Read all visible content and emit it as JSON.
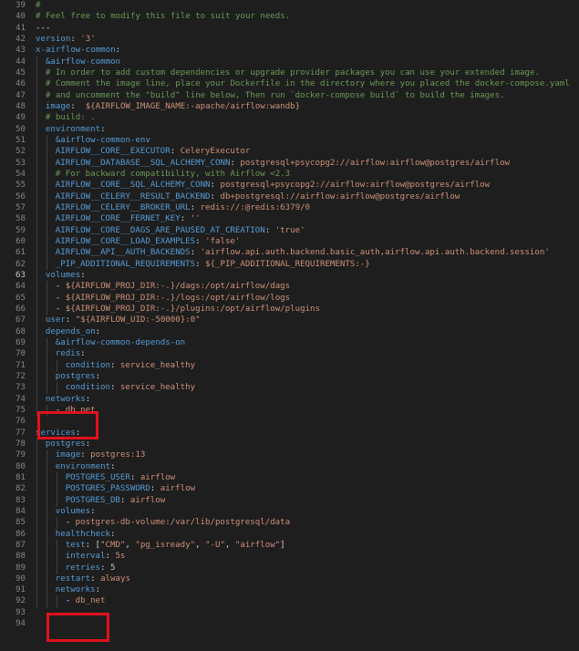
{
  "editor": {
    "language": "yaml",
    "current_line": 63,
    "colors": {
      "background": "#1e1e1e",
      "comment": "#6a9955",
      "key": "#569cd6",
      "string": "#ce9178",
      "number": "#b5cea8",
      "punctuation": "#d4d4d4",
      "line_number": "#858585",
      "highlight_box": "#e0121d"
    },
    "lines": [
      {
        "n": "39",
        "i": 0,
        "t": [
          [
            "cm",
            "#"
          ]
        ]
      },
      {
        "n": "40",
        "i": 0,
        "t": [
          [
            "cm",
            "# Feel free to modify this file to suit your needs."
          ]
        ]
      },
      {
        "n": "41",
        "i": 0,
        "t": [
          [
            "p",
            "---"
          ]
        ]
      },
      {
        "n": "42",
        "i": 0,
        "t": [
          [
            "key",
            "version"
          ],
          [
            "p",
            ": "
          ],
          [
            "str",
            "'3'"
          ]
        ]
      },
      {
        "n": "43",
        "i": 0,
        "t": [
          [
            "key",
            "x-airflow-common"
          ],
          [
            "p",
            ":"
          ]
        ]
      },
      {
        "n": "44",
        "i": 1,
        "t": [
          [
            "anc",
            "&airflow-common"
          ]
        ]
      },
      {
        "n": "45",
        "i": 1,
        "t": [
          [
            "cm",
            "# In order to add custom dependencies or upgrade provider packages you can use your extended image."
          ]
        ]
      },
      {
        "n": "46",
        "i": 1,
        "t": [
          [
            "cm",
            "# Comment the image line, place your Dockerfile in the directory where you placed the docker-compose.yaml"
          ]
        ]
      },
      {
        "n": "47",
        "i": 1,
        "t": [
          [
            "cm",
            "# and uncomment the \"build\" line below, Then run `docker-compose build` to build the images."
          ]
        ]
      },
      {
        "n": "48",
        "i": 1,
        "t": [
          [
            "key",
            "image"
          ],
          [
            "p",
            ":  "
          ],
          [
            "str",
            "${AIRFLOW_IMAGE_NAME:-apache/airflow:wandb}"
          ]
        ]
      },
      {
        "n": "49",
        "i": 1,
        "t": [
          [
            "cm",
            "# build: ."
          ]
        ]
      },
      {
        "n": "50",
        "i": 1,
        "t": [
          [
            "key",
            "environment"
          ],
          [
            "p",
            ":"
          ]
        ]
      },
      {
        "n": "51",
        "i": 2,
        "t": [
          [
            "anc",
            "&airflow-common-env"
          ]
        ]
      },
      {
        "n": "52",
        "i": 2,
        "t": [
          [
            "key",
            "AIRFLOW__CORE__EXECUTOR"
          ],
          [
            "p",
            ": "
          ],
          [
            "str",
            "CeleryExecutor"
          ]
        ]
      },
      {
        "n": "53",
        "i": 2,
        "t": [
          [
            "key",
            "AIRFLOW__DATABASE__SQL_ALCHEMY_CONN"
          ],
          [
            "p",
            ": "
          ],
          [
            "str",
            "postgresql+psycopg2://airflow:airflow@postgres/airflow"
          ]
        ]
      },
      {
        "n": "54",
        "i": 2,
        "t": [
          [
            "cm",
            "# For backward compatibility, with Airflow <2.3"
          ]
        ]
      },
      {
        "n": "55",
        "i": 2,
        "t": [
          [
            "key",
            "AIRFLOW__CORE__SQL_ALCHEMY_CONN"
          ],
          [
            "p",
            ": "
          ],
          [
            "str",
            "postgresql+psycopg2://airflow:airflow@postgres/airflow"
          ]
        ]
      },
      {
        "n": "56",
        "i": 2,
        "t": [
          [
            "key",
            "AIRFLOW__CELERY__RESULT_BACKEND"
          ],
          [
            "p",
            ": "
          ],
          [
            "str",
            "db+postgresql://airflow:airflow@postgres/airflow"
          ]
        ]
      },
      {
        "n": "57",
        "i": 2,
        "t": [
          [
            "key",
            "AIRFLOW__CELERY__BROKER_URL"
          ],
          [
            "p",
            ": "
          ],
          [
            "str",
            "redis://:@redis:6379/0"
          ]
        ]
      },
      {
        "n": "58",
        "i": 2,
        "t": [
          [
            "key",
            "AIRFLOW__CORE__FERNET_KEY"
          ],
          [
            "p",
            ": "
          ],
          [
            "str",
            "''"
          ]
        ]
      },
      {
        "n": "59",
        "i": 2,
        "t": [
          [
            "key",
            "AIRFLOW__CORE__DAGS_ARE_PAUSED_AT_CREATION"
          ],
          [
            "p",
            ": "
          ],
          [
            "str",
            "'true'"
          ]
        ]
      },
      {
        "n": "60",
        "i": 2,
        "t": [
          [
            "key",
            "AIRFLOW__CORE__LOAD_EXAMPLES"
          ],
          [
            "p",
            ": "
          ],
          [
            "str",
            "'false'"
          ]
        ]
      },
      {
        "n": "61",
        "i": 2,
        "t": [
          [
            "key",
            "AIRFLOW__API__AUTH_BACKENDS"
          ],
          [
            "p",
            ": "
          ],
          [
            "str",
            "'airflow.api.auth.backend.basic_auth,airflow.api.auth.backend.session'"
          ]
        ]
      },
      {
        "n": "62",
        "i": 2,
        "t": [
          [
            "key",
            "_PIP_ADDITIONAL_REQUIREMENTS"
          ],
          [
            "p",
            ": "
          ],
          [
            "str",
            "${_PIP_ADDITIONAL_REQUIREMENTS:-}"
          ]
        ]
      },
      {
        "n": "63",
        "i": 1,
        "t": [
          [
            "key",
            "volumes"
          ],
          [
            "p",
            ":"
          ]
        ]
      },
      {
        "n": "64",
        "i": 2,
        "t": [
          [
            "p",
            "- "
          ],
          [
            "str",
            "${AIRFLOW_PROJ_DIR:-.}/dags:/opt/airflow/dags"
          ]
        ]
      },
      {
        "n": "65",
        "i": 2,
        "t": [
          [
            "p",
            "- "
          ],
          [
            "str",
            "${AIRFLOW_PROJ_DIR:-.}/logs:/opt/airflow/logs"
          ]
        ]
      },
      {
        "n": "66",
        "i": 2,
        "t": [
          [
            "p",
            "- "
          ],
          [
            "str",
            "${AIRFLOW_PROJ_DIR:-.}/plugins:/opt/airflow/plugins"
          ]
        ]
      },
      {
        "n": "67",
        "i": 1,
        "t": [
          [
            "key",
            "user"
          ],
          [
            "p",
            ": "
          ],
          [
            "str",
            "\"${AIRFLOW_UID:-50000}:0\""
          ]
        ]
      },
      {
        "n": "68",
        "i": 1,
        "t": [
          [
            "key",
            "depends_on"
          ],
          [
            "p",
            ":"
          ]
        ]
      },
      {
        "n": "69",
        "i": 2,
        "t": [
          [
            "anc",
            "&airflow-common-depends-on"
          ]
        ]
      },
      {
        "n": "70",
        "i": 2,
        "t": [
          [
            "key",
            "redis"
          ],
          [
            "p",
            ":"
          ]
        ]
      },
      {
        "n": "71",
        "i": 3,
        "t": [
          [
            "key",
            "condition"
          ],
          [
            "p",
            ": "
          ],
          [
            "str",
            "service_healthy"
          ]
        ]
      },
      {
        "n": "72",
        "i": 2,
        "t": [
          [
            "key",
            "postgres"
          ],
          [
            "p",
            ":"
          ]
        ]
      },
      {
        "n": "73",
        "i": 3,
        "t": [
          [
            "key",
            "condition"
          ],
          [
            "p",
            ": "
          ],
          [
            "str",
            "service_healthy"
          ]
        ]
      },
      {
        "n": "74",
        "i": 1,
        "t": [
          [
            "key",
            "networks"
          ],
          [
            "p",
            ":"
          ]
        ]
      },
      {
        "n": "75",
        "i": 2,
        "t": [
          [
            "p",
            "- "
          ],
          [
            "str",
            "db_net"
          ]
        ]
      },
      {
        "n": "76",
        "i": 0,
        "t": []
      },
      {
        "n": "77",
        "i": 0,
        "t": [
          [
            "key",
            "services"
          ],
          [
            "p",
            ":"
          ]
        ]
      },
      {
        "n": "78",
        "i": 1,
        "t": [
          [
            "key",
            "postgres"
          ],
          [
            "p",
            ":"
          ]
        ]
      },
      {
        "n": "79",
        "i": 2,
        "t": [
          [
            "key",
            "image"
          ],
          [
            "p",
            ": "
          ],
          [
            "str",
            "postgres:13"
          ]
        ]
      },
      {
        "n": "80",
        "i": 2,
        "t": [
          [
            "key",
            "environment"
          ],
          [
            "p",
            ":"
          ]
        ]
      },
      {
        "n": "81",
        "i": 3,
        "t": [
          [
            "key",
            "POSTGRES_USER"
          ],
          [
            "p",
            ": "
          ],
          [
            "str",
            "airflow"
          ]
        ]
      },
      {
        "n": "82",
        "i": 3,
        "t": [
          [
            "key",
            "POSTGRES_PASSWORD"
          ],
          [
            "p",
            ": "
          ],
          [
            "str",
            "airflow"
          ]
        ]
      },
      {
        "n": "83",
        "i": 3,
        "t": [
          [
            "key",
            "POSTGRES_DB"
          ],
          [
            "p",
            ": "
          ],
          [
            "str",
            "airflow"
          ]
        ]
      },
      {
        "n": "84",
        "i": 2,
        "t": [
          [
            "key",
            "volumes"
          ],
          [
            "p",
            ":"
          ]
        ]
      },
      {
        "n": "85",
        "i": 3,
        "t": [
          [
            "p",
            "- "
          ],
          [
            "str",
            "postgres-db-volume:/var/lib/postgresql/data"
          ]
        ]
      },
      {
        "n": "86",
        "i": 2,
        "t": [
          [
            "key",
            "healthcheck"
          ],
          [
            "p",
            ":"
          ]
        ]
      },
      {
        "n": "87",
        "i": 3,
        "t": [
          [
            "key",
            "test"
          ],
          [
            "p",
            ": ["
          ],
          [
            "str",
            "\"CMD\""
          ],
          [
            "p",
            ", "
          ],
          [
            "str",
            "\"pg_isready\""
          ],
          [
            "p",
            ", "
          ],
          [
            "str",
            "\"-U\""
          ],
          [
            "p",
            ", "
          ],
          [
            "str",
            "\"airflow\""
          ],
          [
            "p",
            "]"
          ]
        ]
      },
      {
        "n": "88",
        "i": 3,
        "t": [
          [
            "key",
            "interval"
          ],
          [
            "p",
            ": "
          ],
          [
            "str",
            "5s"
          ]
        ]
      },
      {
        "n": "89",
        "i": 3,
        "t": [
          [
            "key",
            "retries"
          ],
          [
            "p",
            ": "
          ],
          [
            "num",
            "5"
          ]
        ]
      },
      {
        "n": "90",
        "i": 2,
        "t": [
          [
            "key",
            "restart"
          ],
          [
            "p",
            ": "
          ],
          [
            "str",
            "always"
          ]
        ]
      },
      {
        "n": "91",
        "i": 2,
        "t": [
          [
            "key",
            "networks"
          ],
          [
            "p",
            ":"
          ]
        ]
      },
      {
        "n": "92",
        "i": 3,
        "t": [
          [
            "p",
            "- "
          ],
          [
            "str",
            "db_net"
          ]
        ]
      },
      {
        "n": "93",
        "i": 0,
        "t": []
      },
      {
        "n": "94",
        "i": 0,
        "t": []
      }
    ]
  }
}
